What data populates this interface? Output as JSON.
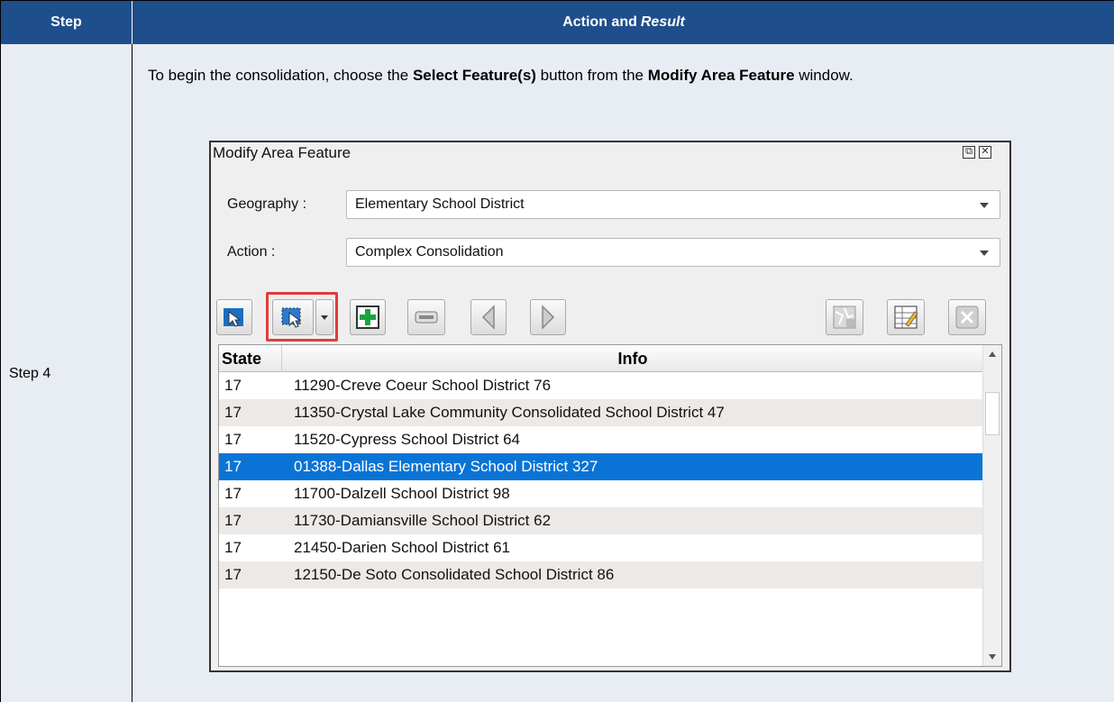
{
  "table": {
    "header": {
      "step": "Step",
      "action_prefix": "Action and",
      "action_result": "Result"
    },
    "row": {
      "step": "Step 4",
      "instruction": {
        "t1": "To begin the consolidation, choose the ",
        "b1": "Select Feature(s)",
        "t2": " button from the ",
        "b2": "Modify Area Feature",
        "t3": " window."
      }
    }
  },
  "window": {
    "title": "Modify Area Feature",
    "geography_label": "Geography :",
    "geography_value": "Elementary School District",
    "action_label": "Action :",
    "action_value": "Complex Consolidation",
    "toolbar": [
      "select-area-button",
      "select-features-button",
      "add-feature-button",
      "remove-feature-button",
      "previous-button",
      "next-button",
      "map-zoom-button",
      "attribute-table-button",
      "close-selection-button"
    ],
    "grid": {
      "col_state": "State",
      "col_info": "Info",
      "rows": [
        {
          "state": "17",
          "info": "11290-Creve Coeur School District 76"
        },
        {
          "state": "17",
          "info": "11350-Crystal Lake Community Consolidated School District 47"
        },
        {
          "state": "17",
          "info": "11520-Cypress School District 64"
        },
        {
          "state": "17",
          "info": "01388-Dallas Elementary School District 327"
        },
        {
          "state": "17",
          "info": "11700-Dalzell School District 98"
        },
        {
          "state": "17",
          "info": "11730-Damiansville School District 62"
        },
        {
          "state": "17",
          "info": "21450-Darien School District 61"
        },
        {
          "state": "17",
          "info": "12150-De Soto Consolidated School District 86"
        }
      ],
      "selected_row": 4
    }
  },
  "colors": {
    "header_bg": "#1f4e8c",
    "row_bg": "#e8edf4",
    "selection": "#0a74d6",
    "highlight": "#e03c3c"
  }
}
